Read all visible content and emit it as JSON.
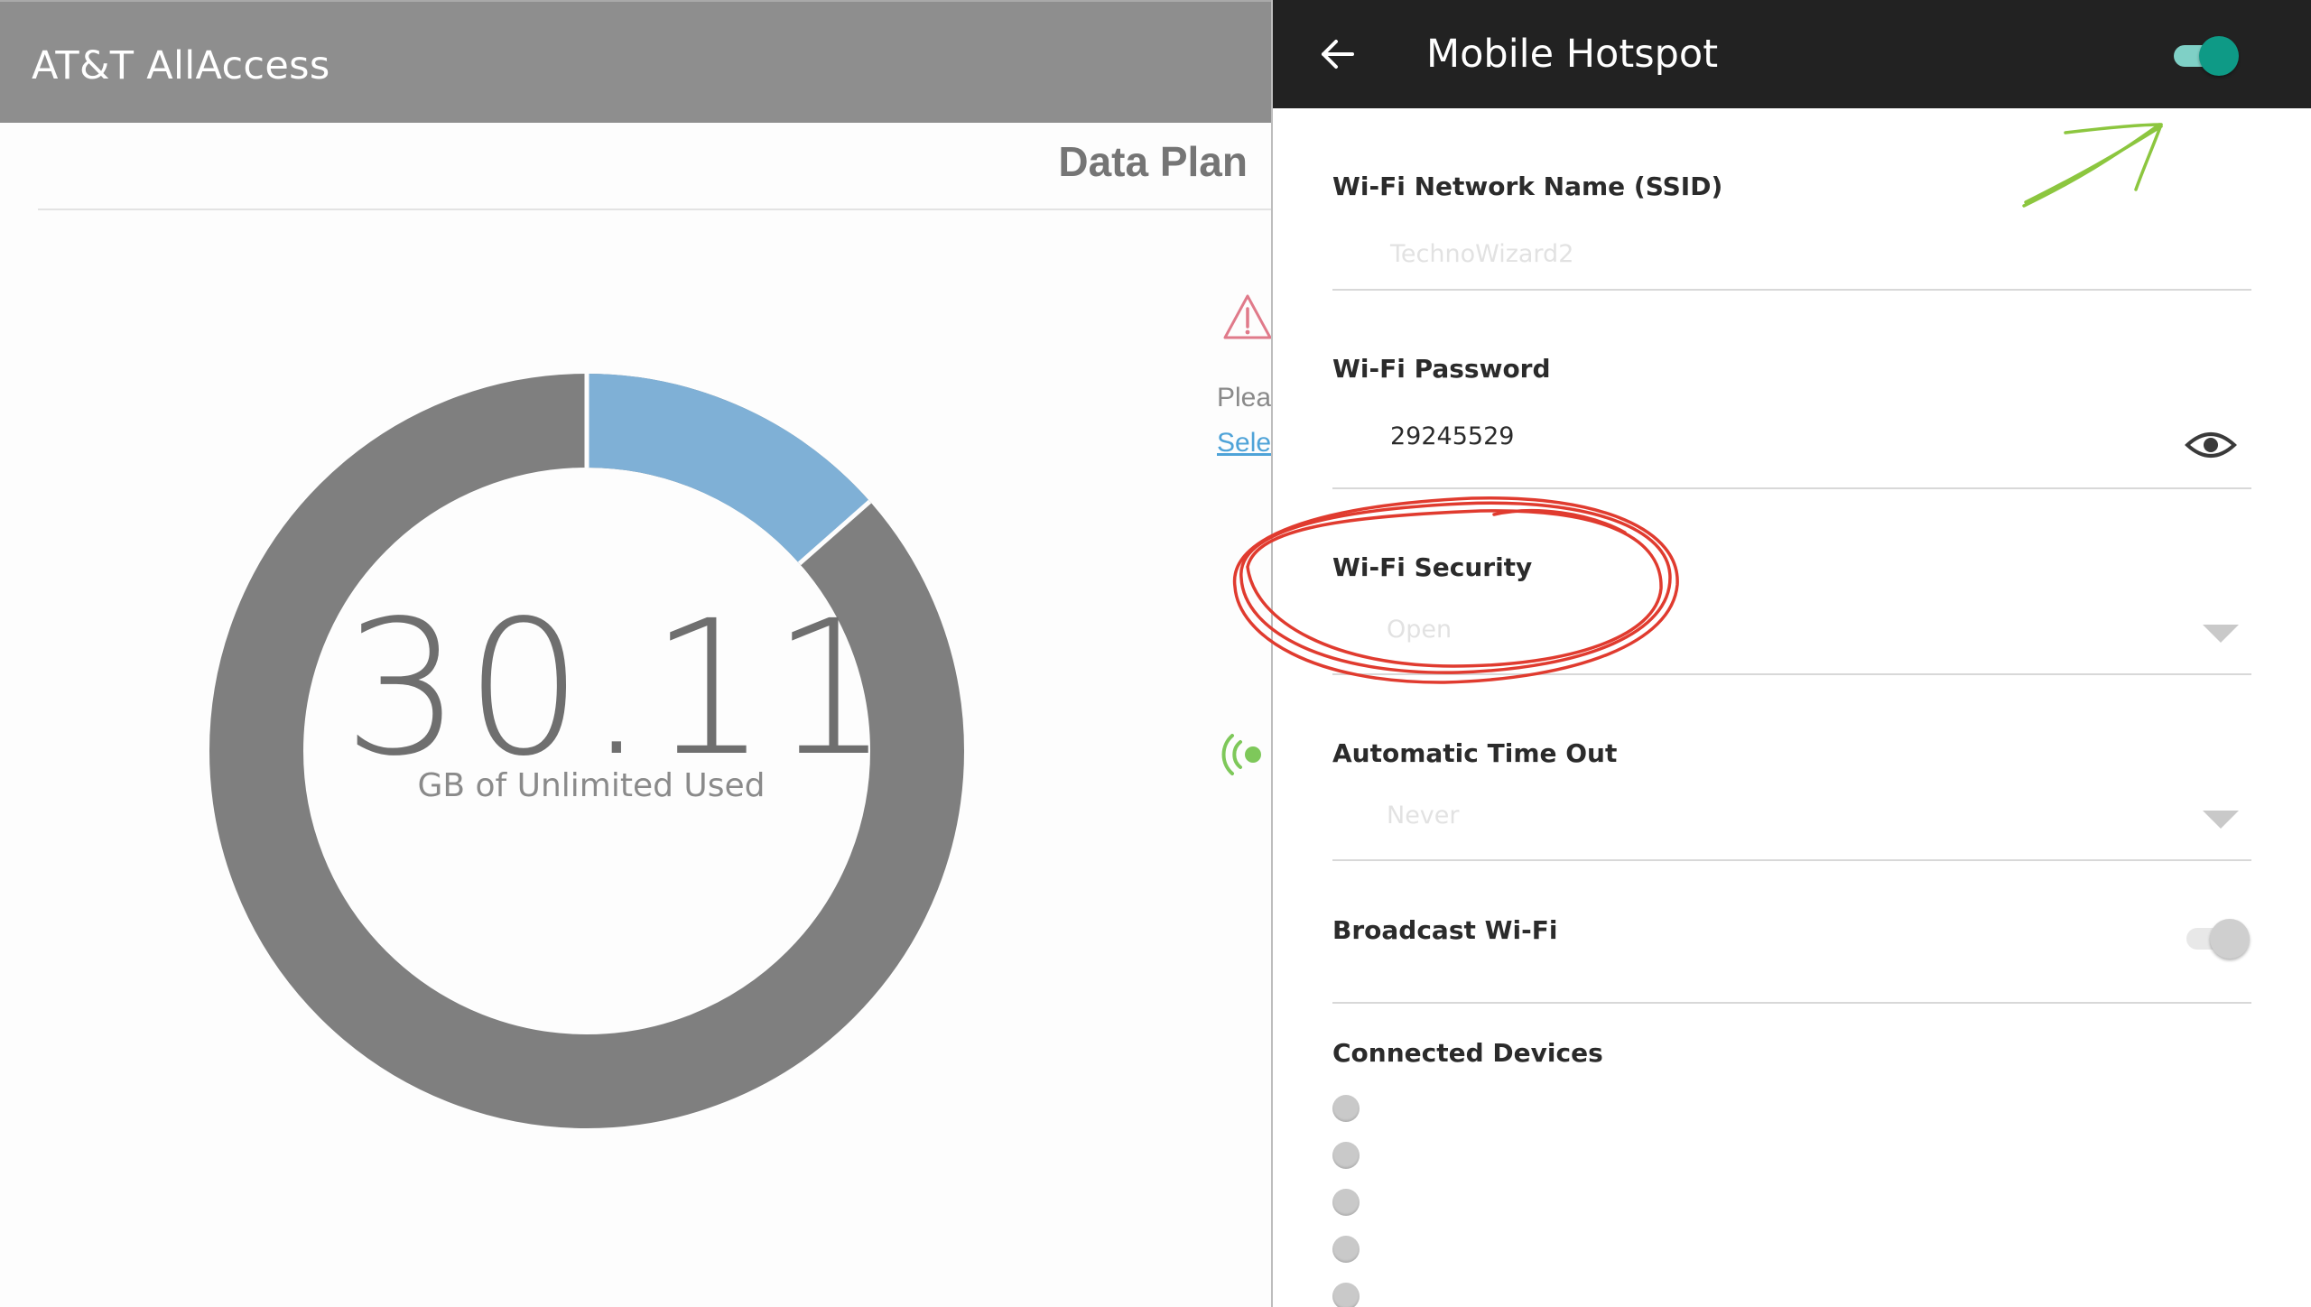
{
  "app": {
    "title": "AT&T AllAccess",
    "section_title": "Data Plan",
    "usage_value": "30.11",
    "usage_label": "GB of Unlimited Used",
    "notice_text": "Plea",
    "notice_link": "Sele",
    "usage_fraction": 0.135,
    "colors": {
      "used": "#7fb0d6",
      "remaining": "#7f7f7f",
      "warning": "#e07a8a",
      "hotspot": "#7ec85a"
    }
  },
  "hotspot": {
    "title": "Mobile Hotspot",
    "enabled": true,
    "ssid_label": "Wi-Fi Network Name (SSID)",
    "ssid_value": "TechnoWizard2",
    "password_label": "Wi-Fi Password",
    "password_value": "29245529",
    "security_label": "Wi-Fi Security",
    "security_value": "Open",
    "timeout_label": "Automatic Time Out",
    "timeout_value": "Never",
    "broadcast_label": "Broadcast Wi-Fi",
    "broadcast_enabled": false,
    "devices_label": "Connected Devices",
    "device_count_visible": 5,
    "colors": {
      "toggle_on": "#0e9a86",
      "header": "#222222"
    }
  },
  "annotations": {
    "circle_color": "#e03b2f",
    "arrow_color": "#8cc63f"
  }
}
